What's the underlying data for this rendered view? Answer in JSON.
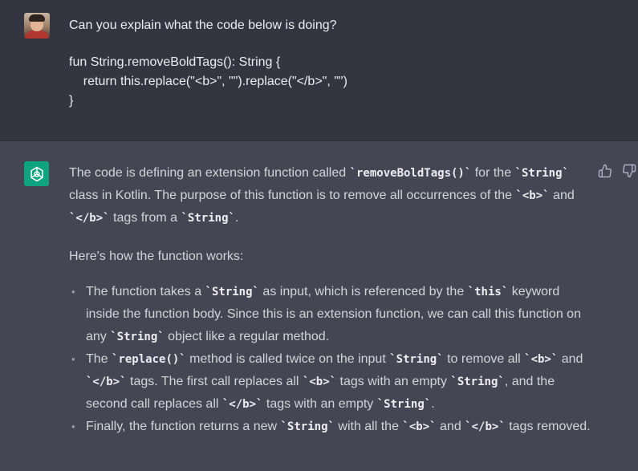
{
  "user": {
    "prompt": "Can you explain what the code below is doing?",
    "code_line1": "fun String.removeBoldTags(): String {",
    "code_line2": "    return this.replace(\"<b>\", \"\").replace(\"</b>\", \"\")",
    "code_line3": "}"
  },
  "assistant": {
    "p1": {
      "t1": "The code is defining an extension function called ",
      "c1": "`removeBoldTags()`",
      "t2": " for the ",
      "c2": "`String`",
      "t3": " class in Kotlin. The purpose of this function is to remove all occurrences of the ",
      "c3": "`<b>`",
      "t4": " and ",
      "c4": "`</b>`",
      "t5": " tags from a ",
      "c5": "`String`",
      "t6": "."
    },
    "p2": "Here's how the function works:",
    "bullets": [
      {
        "t1": "The function takes a ",
        "c1": "`String`",
        "t2": " as input, which is referenced by the ",
        "c2": "`this`",
        "t3": " keyword inside the function body. Since this is an extension function, we can call this function on any ",
        "c3": "`String`",
        "t4": " object like a regular method."
      },
      {
        "t1": "The ",
        "c1": "`replace()`",
        "t2": " method is called twice on the input ",
        "c2": "`String`",
        "t3": " to remove all ",
        "c3": "`<b>`",
        "t4": " and ",
        "c4": "`</b>`",
        "t5": " tags. The first call replaces all ",
        "c5": "`<b>`",
        "t6": " tags with an empty ",
        "c6": "`String`",
        "t7": ", and the second call replaces all ",
        "c7": "`</b>`",
        "t8": " tags with an empty ",
        "c8": "`String`",
        "t9": "."
      },
      {
        "t1": "Finally, the function returns a new ",
        "c1": "`String`",
        "t2": " with all the ",
        "c2": "`<b>`",
        "t3": " and ",
        "c3": "`</b>`",
        "t4": " tags removed."
      }
    ]
  },
  "icons": {
    "user_avatar": "user-avatar",
    "assistant_avatar": "openai-logo-icon",
    "thumbs_up": "thumbs-up-icon",
    "thumbs_down": "thumbs-down-icon"
  },
  "colors": {
    "user_bg": "#343541",
    "assistant_bg": "#444654",
    "logo_bg": "#10a37f"
  }
}
